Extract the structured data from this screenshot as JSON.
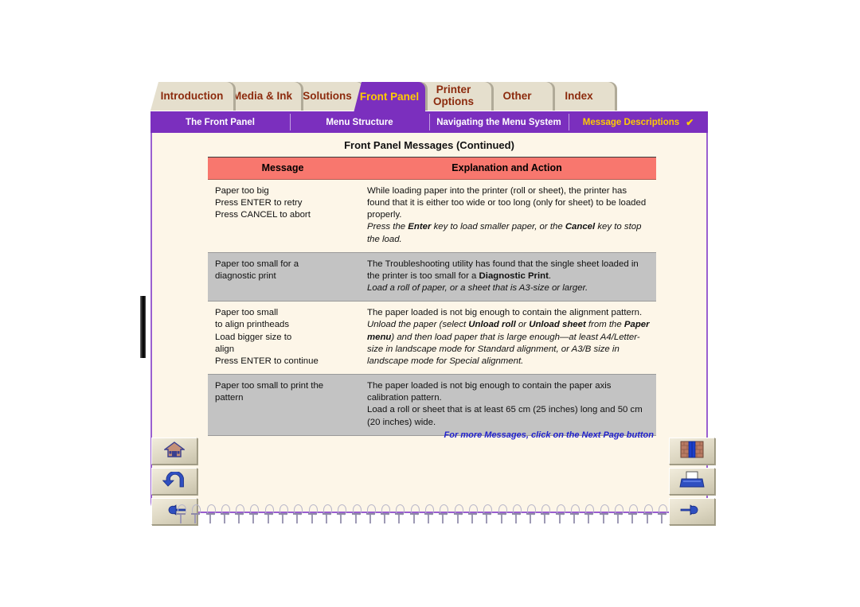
{
  "tabs": [
    {
      "label": "Introduction",
      "active": false,
      "name": "tab-introduction"
    },
    {
      "label": "Media & Ink",
      "active": false,
      "name": "tab-media-and-ink"
    },
    {
      "label": "Solutions",
      "active": false,
      "name": "tab-solutions"
    },
    {
      "label": "Front Panel",
      "active": true,
      "name": "tab-front-panel"
    },
    {
      "label": "Printer\nOptions",
      "active": false,
      "name": "tab-printer-options"
    },
    {
      "label": "Other",
      "active": false,
      "name": "tab-other"
    },
    {
      "label": "Index",
      "active": false,
      "name": "tab-index"
    }
  ],
  "subnav": {
    "items": [
      {
        "label": "The Front Panel",
        "current": false
      },
      {
        "label": "Menu Structure",
        "current": false
      },
      {
        "label": "Navigating the Menu System",
        "current": false
      },
      {
        "label": "Message Descriptions",
        "current": true
      }
    ],
    "check_glyph": "✔"
  },
  "page": {
    "title": "Front Panel Messages (Continued)",
    "footnote": "For more Messages, click on the Next Page button"
  },
  "table": {
    "headers": [
      "Message",
      "Explanation and Action"
    ],
    "rows": [
      {
        "shaded": false,
        "message": "Paper too big\nPress ENTER to retry\nPress CANCEL to abort",
        "explanation_plain": "While loading paper into the printer (roll or sheet), the printer has found that it is either too wide or too long (only for sheet) to be loaded properly.",
        "explanation_italic_parts": [
          "Press the ",
          "Enter",
          " key to load smaller paper, or the ",
          "Cancel",
          " key to stop the load."
        ]
      },
      {
        "shaded": true,
        "message": "Paper too small for a\ndiagnostic print",
        "explanation_plain_parts": [
          "The Troubleshooting utility has found that the single sheet loaded in the printer is too small for a ",
          "Diagnostic Print",
          "."
        ],
        "explanation_italic_parts": [
          "Load a roll of paper, or a sheet that is A3-size or larger."
        ]
      },
      {
        "shaded": false,
        "message": "Paper too small\nto align printheads\nLoad bigger size to\nalign\nPress ENTER to continue",
        "explanation_plain": "The paper loaded is not big enough to contain the alignment pattern.",
        "explanation_italic_parts": [
          "Unload the paper (select ",
          "Unload roll",
          " or ",
          "Unload sheet",
          " from the ",
          "Paper menu",
          ") and then load paper that is large enough—at least A4/Letter-size in landscape mode for Standard alignment, or A3/B size in landscape mode for Special alignment."
        ]
      },
      {
        "shaded": true,
        "message": "Paper too small to print the\npattern",
        "explanation_plain": "The paper loaded is not big enough to contain the paper axis calibration pattern.\nLoad a roll or sheet that is at least 65 cm (25 inches) long and 50 cm (20 inches) wide."
      }
    ]
  },
  "buttons": {
    "home": {
      "icon": "home-icon",
      "title": "Home"
    },
    "back": {
      "icon": "back-arrow-icon",
      "title": "Back"
    },
    "prev_page": {
      "icon": "previous-page-hand-icon",
      "title": "Previous Page"
    },
    "index": {
      "icon": "index-bookshelf-icon",
      "title": "Index"
    },
    "print": {
      "icon": "printer-icon",
      "title": "Print"
    },
    "next_page": {
      "icon": "next-page-hand-icon",
      "title": "Next Page"
    }
  },
  "colors": {
    "purple": "#7b2fbe",
    "tab_inactive_bg": "#e5dfcd",
    "tab_inactive_text": "#8c2b0e",
    "active_tab_text": "#ffcc00",
    "table_header_bg": "#f8776e",
    "row_shaded_bg": "#c3c3c3",
    "page_bg": "#fdf6e8",
    "footnote_color": "#2222cc"
  }
}
